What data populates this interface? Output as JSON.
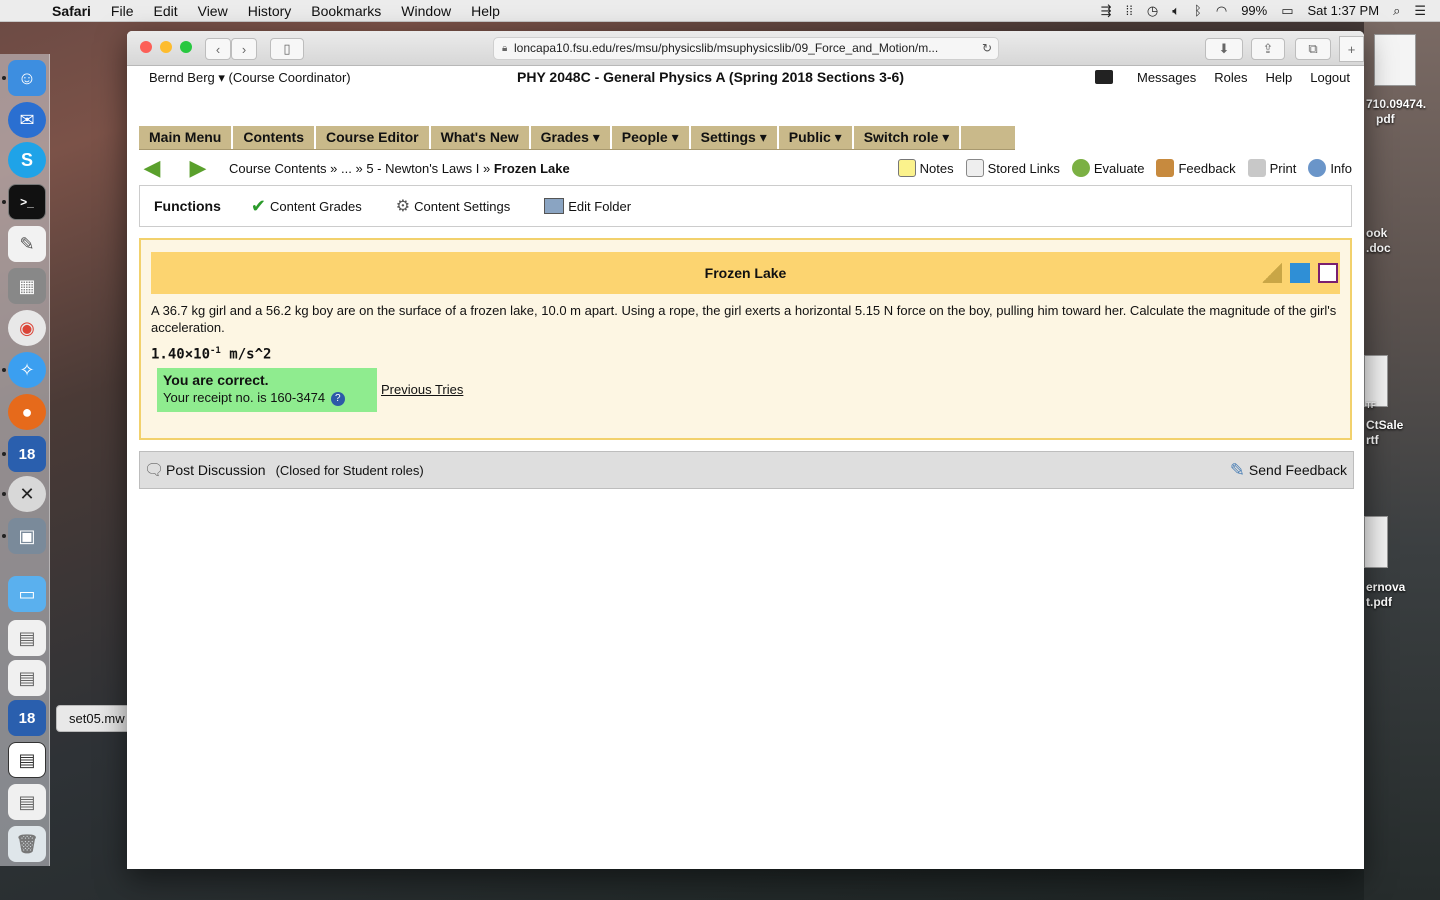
{
  "menubar": {
    "app": "Safari",
    "items": [
      "File",
      "Edit",
      "View",
      "History",
      "Bookmarks",
      "Window",
      "Help"
    ],
    "battery": "99%",
    "clock": "Sat 1:37 PM"
  },
  "dock": {
    "tooltip": "set05.mw",
    "badge_a": "18",
    "badge_b": "18"
  },
  "desktop_files": {
    "f1": "710.09474.",
    "f1b": "pdf",
    "f2": "ook",
    "f2b": ".doc",
    "f3": "TF",
    "f4": "CtSale",
    "f4b": "rtf",
    "f5": "ernova",
    "f5b": "t.pdf"
  },
  "browser": {
    "url": "loncapa10.fsu.edu/res/msu/physicslib/msuphysicslib/09_Force_and_Motion/m..."
  },
  "header": {
    "user": "Bernd Berg ▾",
    "role": "(Course Coordinator)",
    "course": "PHY 2048C - General Physics A (Spring 2018 Sections 3-6)",
    "links": [
      "Messages",
      "Roles",
      "Help",
      "Logout"
    ]
  },
  "mainnav": [
    "Main Menu",
    "Contents",
    "Course Editor",
    "What's New",
    "Grades ▾",
    "People ▾",
    "Settings ▾",
    "Public ▾",
    "Switch role ▾"
  ],
  "breadcrumb": {
    "part1": "Course Contents »",
    "part2": "... »",
    "part3": "5 - Newton's Laws I »",
    "current": "Frozen Lake"
  },
  "tools": [
    "Notes",
    "Stored Links",
    "Evaluate",
    "Feedback",
    "Print",
    "Info"
  ],
  "functions": {
    "title": "Functions",
    "items": [
      "Content Grades",
      "Content Settings",
      "Edit Folder"
    ]
  },
  "problem": {
    "title": "Frozen Lake",
    "text": "A 36.7 kg girl and a 56.2 kg boy are on the surface of a frozen lake, 10.0 m apart. Using a rope, the girl exerts a horizontal 5.15 N force on the boy, pulling him toward her. Calculate the magnitude of the girl's acceleration.",
    "answer_mantissa": "1.40×10",
    "answer_exp": "-1",
    "answer_unit": " m/s^2",
    "correct_title": "You are correct.",
    "receipt": "Your receipt no. is 160-3474",
    "help_icon": "?",
    "previous_tries": "Previous Tries"
  },
  "discussion": {
    "post": "Post Discussion",
    "closed": "(Closed for Student roles)",
    "send_feedback": "Send Feedback"
  }
}
